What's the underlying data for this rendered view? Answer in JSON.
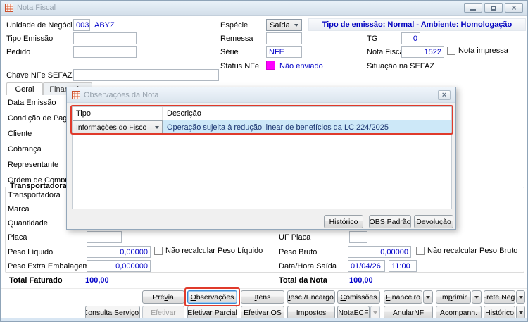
{
  "window": {
    "title": "Nota Fiscal",
    "banner": "Tipo de emissão: Normal - Ambiente: Homologação"
  },
  "colors": {
    "value_blue": "#0000C8",
    "banner_blue": "#0000C0",
    "highlight_red": "#E03A2B",
    "status_magenta": "#FF00FF",
    "selection_blue": "#CDE8F8"
  },
  "top_form": {
    "unidade_negocio": {
      "label": "Unidade de Negócio",
      "code": "003",
      "name": "ABYZ"
    },
    "tipo_emissao": {
      "label": "Tipo Emissão",
      "value": ""
    },
    "pedido": {
      "label": "Pedido",
      "value": ""
    },
    "chave_nfe": {
      "label": "Chave NFe SEFAZ",
      "value": ""
    },
    "especie": {
      "label": "Espécie",
      "value": "Saída"
    },
    "remessa": {
      "label": "Remessa",
      "value": ""
    },
    "serie": {
      "label": "Série",
      "value": "NFE"
    },
    "status_nfe": {
      "label": "Status NFe",
      "value": "Não enviado"
    },
    "tg": {
      "label": "TG",
      "value": "0"
    },
    "nota_fiscal": {
      "label": "Nota Fiscal",
      "value": "1522"
    },
    "nota_impressa": {
      "label": "Nota impressa"
    },
    "situacao_sefaz": {
      "label": "Situação na SEFAZ"
    }
  },
  "tabs": {
    "geral": "Geral",
    "financeiro": "Financeiro"
  },
  "detail": {
    "data_emissao": "Data Emissão",
    "condicao_pagamento": "Condição de Pagamento",
    "cliente": "Cliente",
    "cobranca": "Cobrança",
    "representante": "Representante",
    "ordem_compra": "Ordem de Compra",
    "grupo_transportadora": "Transportadora",
    "transportadora": "Transportadora",
    "marca": "Marca",
    "quantidade": "Quantidade",
    "placa": "Placa",
    "uf_placa": "UF Placa",
    "peso_liquido": {
      "label": "Peso Líquido",
      "value": "0,00000",
      "checkbox": "Não recalcular Peso Líquido"
    },
    "peso_bruto": {
      "label": "Peso Bruto",
      "value": "0,00000",
      "checkbox": "Não recalcular Peso Bruto"
    },
    "peso_extra": {
      "label": "Peso Extra Embalagem",
      "value": "0,000000"
    },
    "data_hora_saida": {
      "label": "Data/Hora Saída",
      "date": "01/04/26",
      "time": "11:00"
    }
  },
  "totals": {
    "faturado_label": "Total Faturado",
    "faturado_value": "100,00",
    "nota_label": "Total da Nota",
    "nota_value": "100,00"
  },
  "modal": {
    "title": "Observações da Nota",
    "table": {
      "headers": [
        "Tipo",
        "Descrição"
      ],
      "rows": [
        {
          "tipo": "Informações do Fisco",
          "descricao": "Operação sujeita à redução linear de benefícios da LC 224/2025"
        }
      ]
    },
    "buttons": {
      "historico": "&Histórico",
      "obs_padrao": "&OBS Padrão",
      "devolucao": "Devolução"
    }
  },
  "toolbar": {
    "previa": "Pré&via",
    "observacoes": "&Observações",
    "itens": "&Itens",
    "desc_encargos": "&Desc./Encargos",
    "comissoes": "&Comissões",
    "financeiro": "&Financeiro",
    "imprimir": "Im&primir",
    "frete_neg": "Frete Ne&g.",
    "consulta_servicos": "Consulta Servi&ços",
    "efetivar": "Efe&tivar",
    "efetivar_parcial": "Efetivar Par&cial",
    "efetivar_os": "Efetivar O&S",
    "impostos": "&Impostos",
    "nota_ecf": "Nota &ECF",
    "anular_nf": "Anular &NF",
    "acompanh": "&Acompanh.",
    "historico": "&Histórico"
  }
}
